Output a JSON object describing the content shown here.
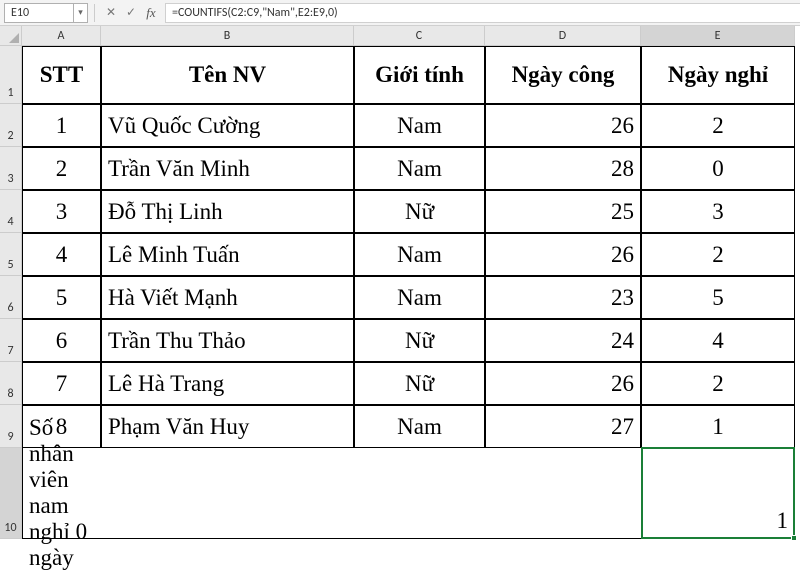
{
  "name_box": "E10",
  "formula": "=COUNTIFS(C2:C9,\"Nam\",E2:E9,0)",
  "col_labels": [
    "A",
    "B",
    "C",
    "D",
    "E"
  ],
  "active_col_index": 4,
  "row_labels": [
    "1",
    "2",
    "3",
    "4",
    "5",
    "6",
    "7",
    "8",
    "9",
    "10"
  ],
  "active_row_index": 9,
  "table": {
    "headers": [
      "STT",
      "Tên NV",
      "Giới tính",
      "Ngày công",
      "Ngày nghỉ"
    ],
    "rows": [
      {
        "stt": "1",
        "name": "Vũ Quốc Cường",
        "gender": "Nam",
        "days": "26",
        "off": "2"
      },
      {
        "stt": "2",
        "name": "Trần Văn Minh",
        "gender": "Nam",
        "days": "28",
        "off": "0"
      },
      {
        "stt": "3",
        "name": "Đỗ Thị Linh",
        "gender": "Nữ",
        "days": "25",
        "off": "3"
      },
      {
        "stt": "4",
        "name": "Lê Minh Tuấn",
        "gender": "Nam",
        "days": "26",
        "off": "2"
      },
      {
        "stt": "5",
        "name": "Hà Viết Mạnh",
        "gender": "Nam",
        "days": "23",
        "off": "5"
      },
      {
        "stt": "6",
        "name": "Trần Thu Thảo",
        "gender": "Nữ",
        "days": "24",
        "off": "4"
      },
      {
        "stt": "7",
        "name": "Lê Hà Trang",
        "gender": "Nữ",
        "days": "26",
        "off": "2"
      },
      {
        "stt": "8",
        "name": "Phạm Văn Huy",
        "gender": "Nam",
        "days": "27",
        "off": "1"
      }
    ],
    "summary_label": "Số nhân viên nam nghỉ 0 ngày",
    "summary_value": "1"
  },
  "icons": {
    "dropdown": "▾",
    "cancel": "✕",
    "enter": "✓",
    "fx": "fx"
  }
}
